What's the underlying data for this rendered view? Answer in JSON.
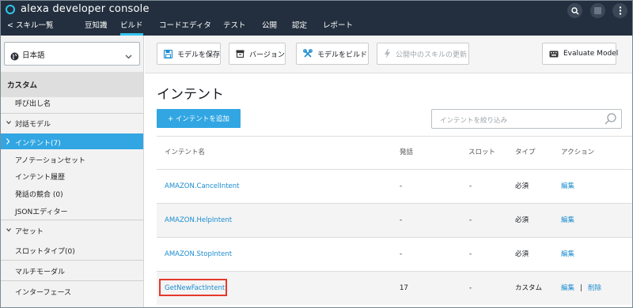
{
  "app": {
    "brand": "alexa developer console"
  },
  "nav": {
    "back": "< スキル一覧",
    "items": [
      "豆知識",
      "ビルド",
      "コードエディタ",
      "テスト",
      "公開",
      "認定",
      "レポート"
    ],
    "active": "ビルド"
  },
  "sidebar": {
    "language": "日本語",
    "header": "カスタム",
    "items": {
      "invocation": "呼び出し名",
      "dialog_model": "対話モデル",
      "intents": "インテント(7)",
      "annotation_sets": "アノテーションセット",
      "intent_history": "インテント履歴",
      "utterance_conflicts": "発話の競合 (0)",
      "json_editor": "JSONエディター",
      "assets": "アセット",
      "slot_types": "スロットタイプ(0)",
      "multimodal": "マルチモーダル",
      "interfaces": "インターフェース"
    }
  },
  "toolbar": {
    "save": "モデルを保存",
    "version": "バージョン",
    "build": "モデルをビルド",
    "update_live": "公開中のスキルの更新",
    "evaluate": "Evaluate Model"
  },
  "main": {
    "title": "インテント",
    "add_button": "+ インテントを追加",
    "filter_placeholder": "インテントを絞り込み"
  },
  "table": {
    "headers": {
      "name": "インテント名",
      "utterances": "発話",
      "slots": "スロット",
      "type": "タイプ",
      "actions": "アクション"
    },
    "rows": [
      {
        "name": "AMAZON.CancelIntent",
        "utterances": "-",
        "slots": "-",
        "type": "必須",
        "edit": "編集",
        "sep": "",
        "delete": ""
      },
      {
        "name": "AMAZON.HelpIntent",
        "utterances": "-",
        "slots": "-",
        "type": "必須",
        "edit": "編集",
        "sep": "",
        "delete": ""
      },
      {
        "name": "AMAZON.StopIntent",
        "utterances": "-",
        "slots": "-",
        "type": "必須",
        "edit": "編集",
        "sep": "",
        "delete": ""
      },
      {
        "name": "GetNewFactIntent",
        "utterances": "17",
        "slots": "-",
        "type": "カスタム",
        "edit": "編集",
        "sep": "|",
        "delete": "削除"
      }
    ]
  },
  "colors": {
    "topbar": "#232f3e",
    "accent": "#31a6e3",
    "link": "#1a8ccf",
    "highlight": "#e5392b"
  },
  "icons": {
    "logo": "alexa-ring-icon",
    "search": "search-icon",
    "apps": "apps-square-icon",
    "more": "more-vertical-icon",
    "language": "globe-icon",
    "save": "save-disk-icon",
    "version": "archive-box-icon",
    "build": "wrench-tools-icon",
    "update": "lightning-icon",
    "evaluate": "keyboard-icon"
  }
}
